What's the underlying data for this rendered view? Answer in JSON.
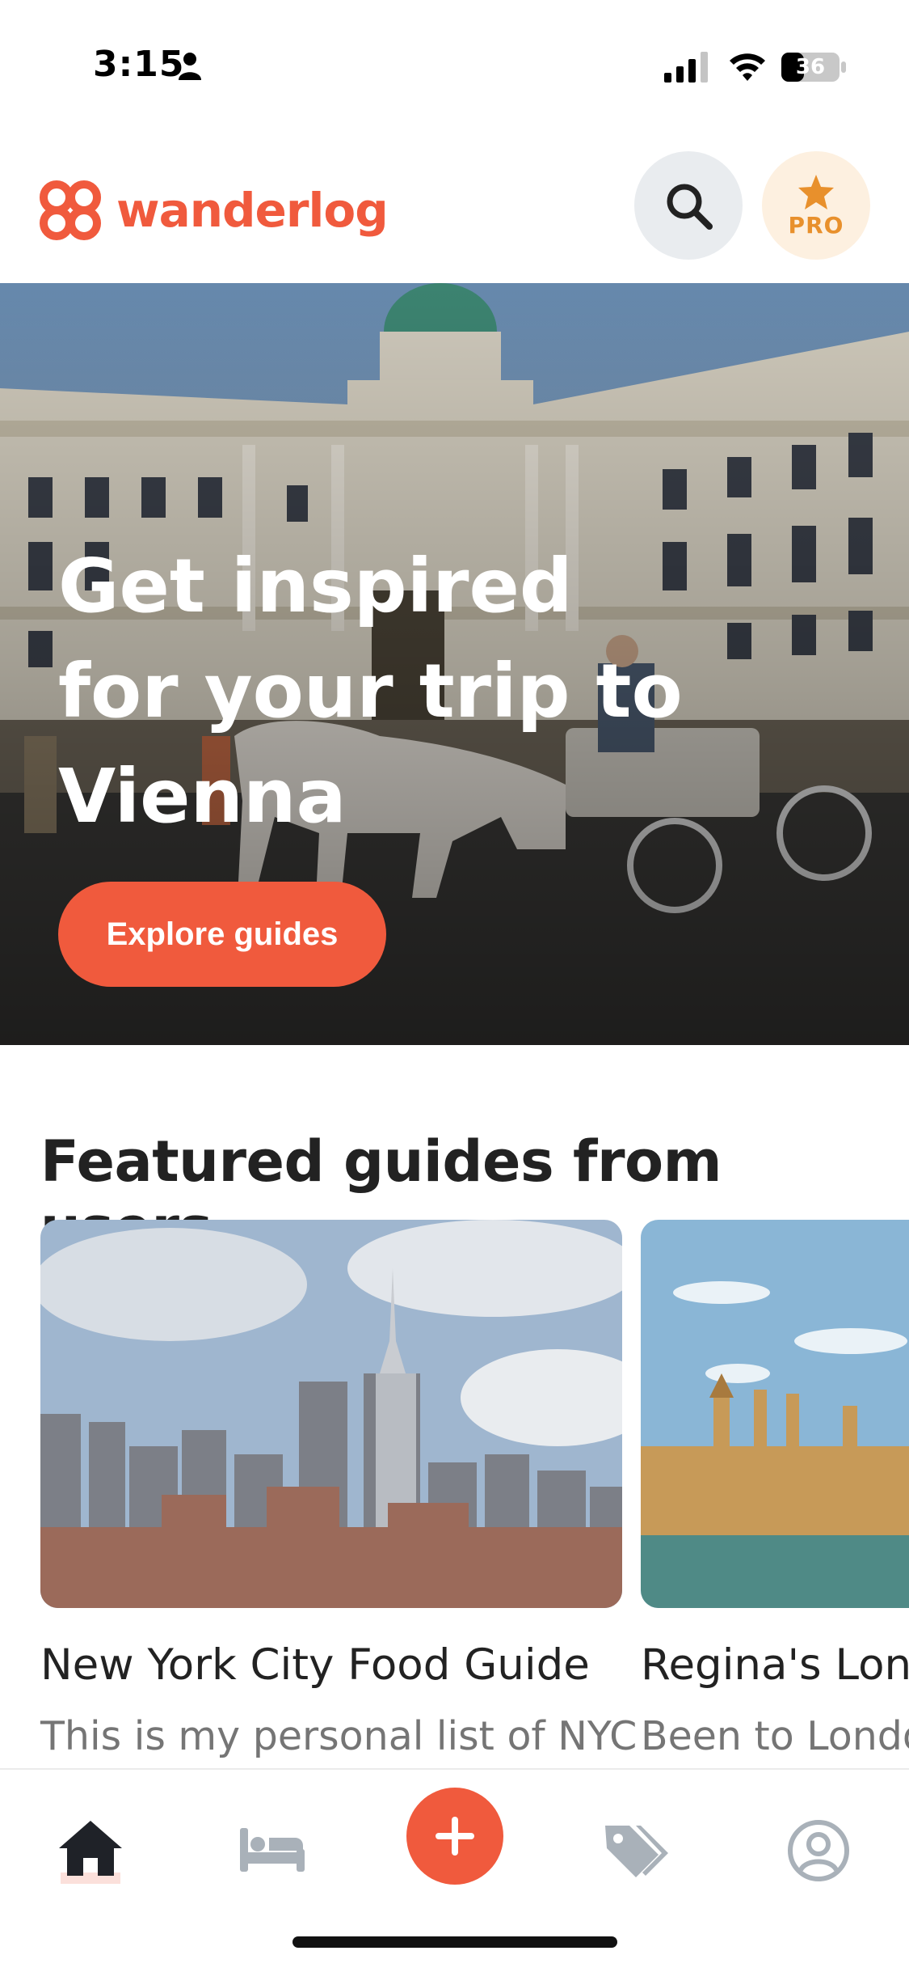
{
  "status_bar": {
    "time": "3:15",
    "battery": "36"
  },
  "header": {
    "brand": "wanderlog",
    "pro_label": "PRO"
  },
  "hero": {
    "title": "Get inspired for your trip to Vienna",
    "button_label": "Explore guides"
  },
  "featured": {
    "section_title": "Featured guides from users",
    "guides": [
      {
        "title": "New York City Food Guide",
        "subtitle": "This is my personal list of NYC"
      },
      {
        "title": "Regina's London Guide",
        "subtitle": "Been to London"
      }
    ]
  },
  "nav": {
    "items": [
      {
        "icon": "home-icon",
        "active": true
      },
      {
        "icon": "bed-icon",
        "active": false
      },
      {
        "icon": "plus-icon",
        "active": false
      },
      {
        "icon": "tag-icon",
        "active": false
      },
      {
        "icon": "profile-icon",
        "active": false
      }
    ]
  },
  "colors": {
    "accent": "#f05a3d",
    "pro": "#e8902c"
  }
}
